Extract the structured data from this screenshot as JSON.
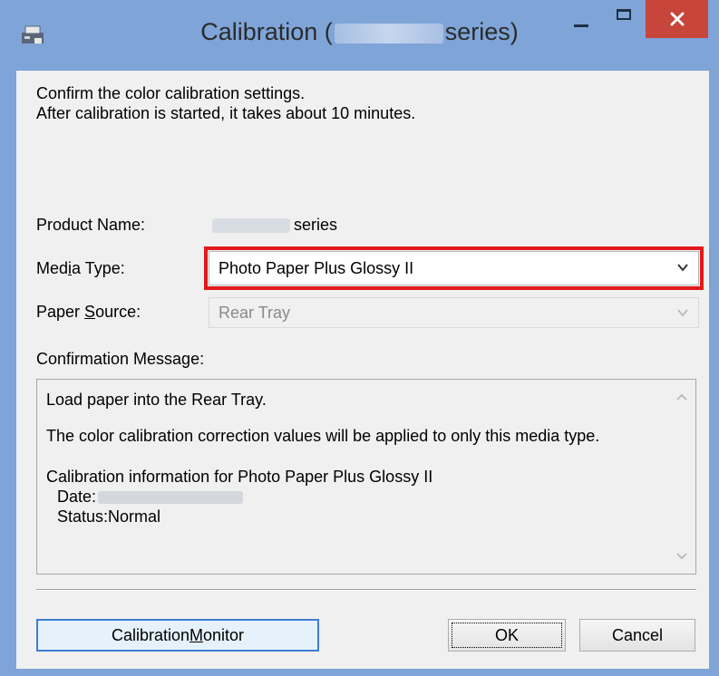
{
  "window": {
    "title_prefix": "Calibration (",
    "title_suffix": "series)",
    "icons": {
      "app": "printer-app-icon",
      "minimize": "minimize-icon",
      "maximize": "maximize-icon",
      "close": "close-icon"
    },
    "colors": {
      "titlebar": "#7fa4d8",
      "close": "#c7453a",
      "highlight": "#e11a1a"
    }
  },
  "intro": {
    "line1": "Confirm the color calibration settings.",
    "line2": "After calibration is started, it takes about 10 minutes."
  },
  "product": {
    "label": "Product Name:",
    "value_suffix": "series"
  },
  "media": {
    "label_pre": "Med",
    "label_u": "i",
    "label_post": "a Type:",
    "value": "Photo Paper Plus Glossy II"
  },
  "source": {
    "label_pre": "Paper ",
    "label_u": "S",
    "label_post": "ource:",
    "value": "Rear Tray"
  },
  "confirmation": {
    "label": "Confirmation Message:",
    "lines": [
      "Load paper into the Rear Tray.",
      "The color calibration correction values will be applied to only this media type.",
      "Calibration information for Photo Paper Plus Glossy II",
      "Date:",
      "Status:Normal"
    ]
  },
  "buttons": {
    "calibration_pre": "Calibration ",
    "calibration_u": "M",
    "calibration_post": "onitor",
    "ok": "OK",
    "cancel": "Cancel"
  }
}
